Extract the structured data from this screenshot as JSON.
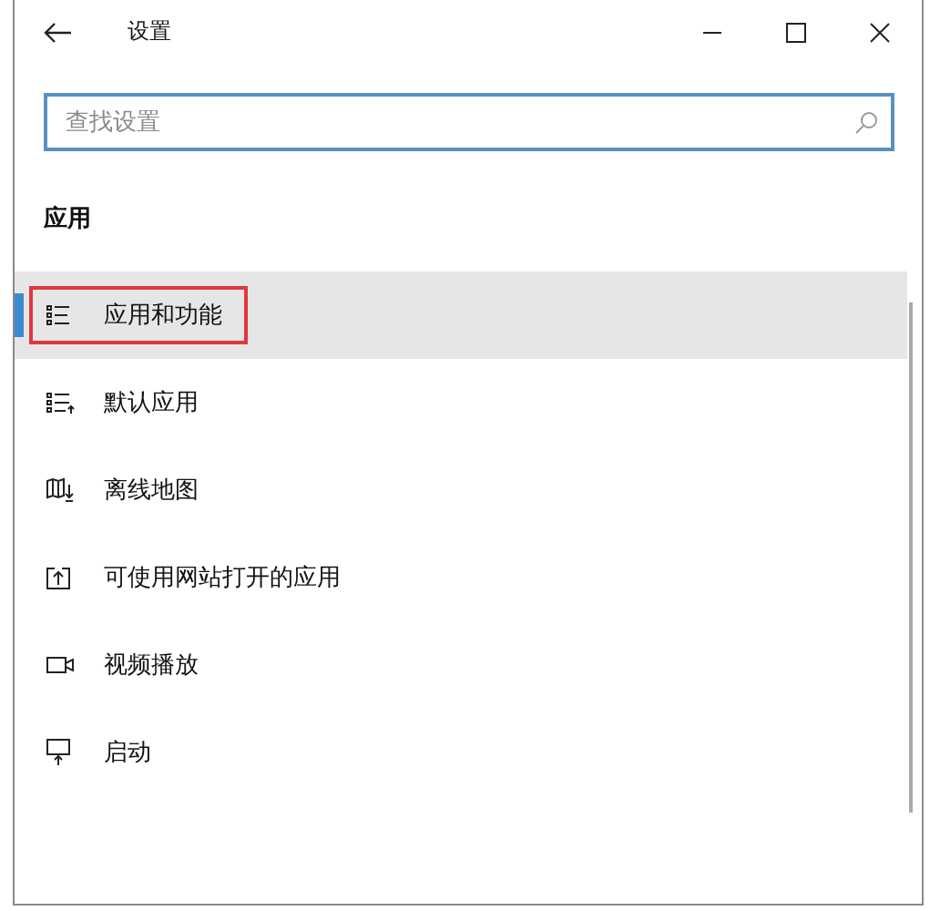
{
  "window": {
    "title": "设置"
  },
  "search": {
    "placeholder": "查找设置"
  },
  "section_title": "应用",
  "nav_items": [
    {
      "label": "应用和功能",
      "selected": true,
      "annotated": true
    },
    {
      "label": "默认应用",
      "selected": false,
      "annotated": false
    },
    {
      "label": "离线地图",
      "selected": false,
      "annotated": false
    },
    {
      "label": "可使用网站打开的应用",
      "selected": false,
      "annotated": false
    },
    {
      "label": "视频播放",
      "selected": false,
      "annotated": false
    },
    {
      "label": "启动",
      "selected": false,
      "annotated": false
    }
  ]
}
